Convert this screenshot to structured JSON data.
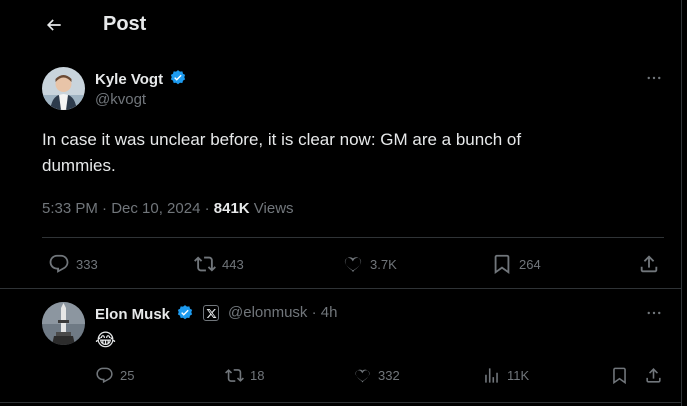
{
  "header": {
    "title": "Post"
  },
  "post": {
    "author_name": "Kyle Vogt",
    "author_handle": "@kvogt",
    "text_line1": "In case it was unclear before, it is clear now: GM are a bunch of",
    "text_line2": "dummies.",
    "timestamp": "5:33 PM · Dec 10, 2024 · ",
    "views_count": "841K",
    "views_label": " Views",
    "replies": "333",
    "reposts": "443",
    "likes": "3.7K",
    "bookmarks": "264"
  },
  "reply": {
    "author_name": "Elon Musk",
    "author_handle": "@elonmusk · 4h",
    "text": "😂",
    "replies": "25",
    "reposts": "18",
    "likes": "332",
    "views": "11K"
  },
  "colors": {
    "background": "#000000",
    "text": "#e7e9ea",
    "muted": "#71767b",
    "verified": "#1d9bf0",
    "divider": "#2f3336"
  }
}
